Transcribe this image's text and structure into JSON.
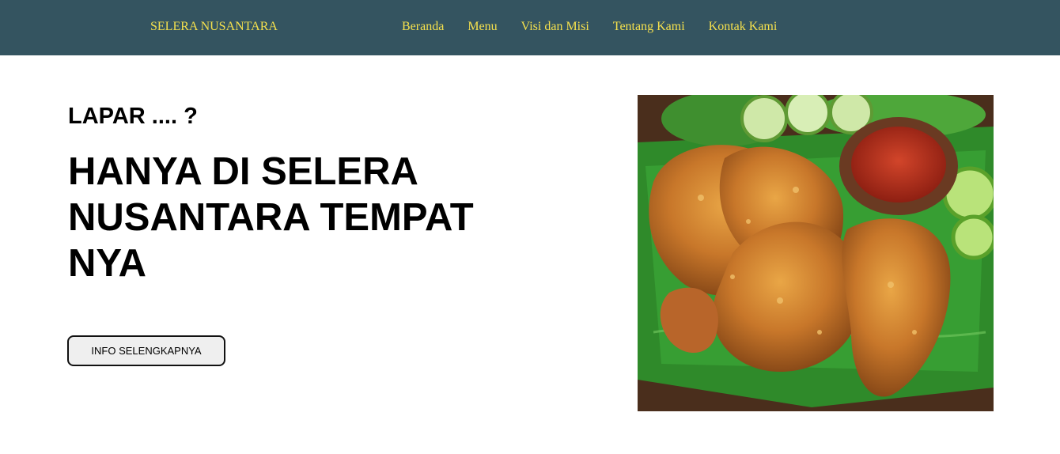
{
  "navbar": {
    "brand": "SELERA NUSANTARA",
    "links": [
      "Beranda",
      "Menu",
      "Visi dan Misi",
      "Tentang Kami",
      "Kontak Kami"
    ]
  },
  "hero": {
    "tagline": "LAPAR .... ?",
    "headline": "HANYA DI SELERA NUSANTARA TEMPAT NYA",
    "button_label": "INFO SELENGKAPNYA",
    "image_alt": "fried-chicken-food-photo"
  },
  "colors": {
    "navbar_bg": "#345460",
    "nav_text": "#f4e04d",
    "page_bg": "#ffffff",
    "button_bg": "#efefef"
  }
}
